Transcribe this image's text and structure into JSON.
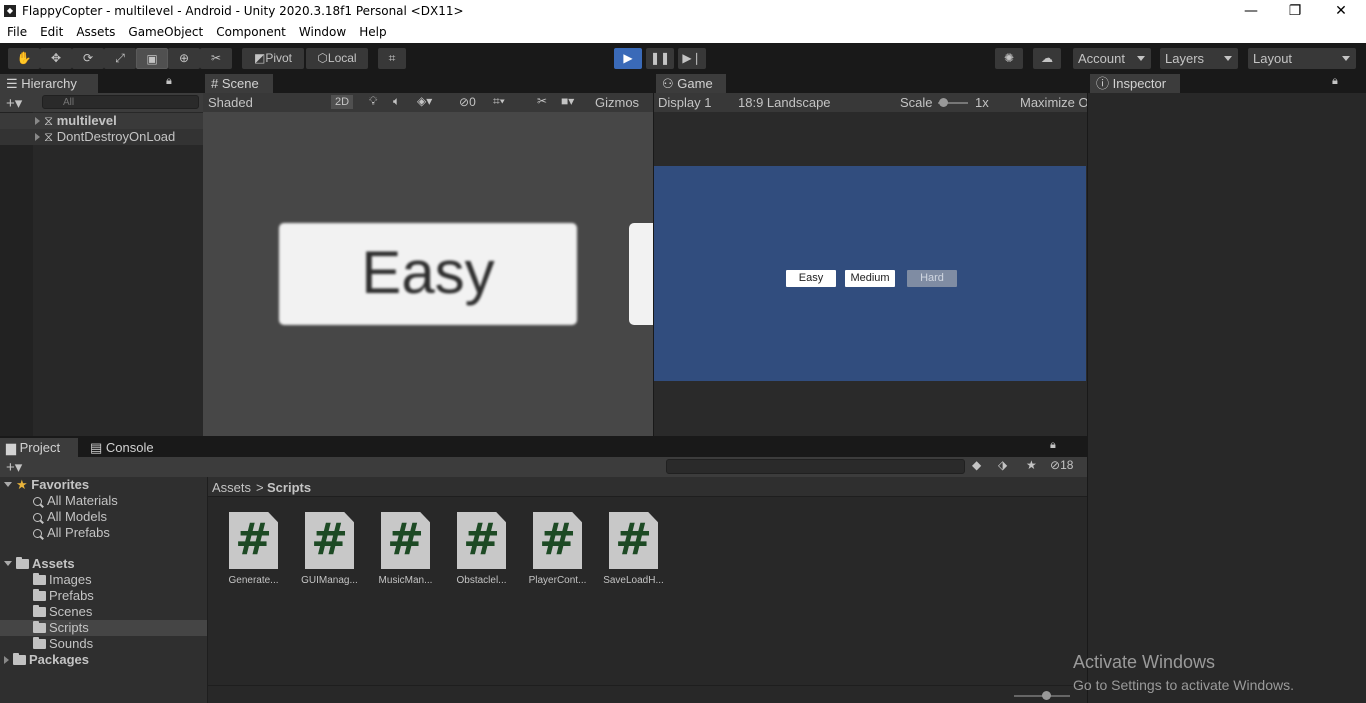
{
  "window": {
    "title": "FlappyCopter - multilevel - Android - Unity 2020.3.18f1 Personal <DX11>",
    "minimize": "—",
    "maximize": "❐",
    "close": "✕"
  },
  "menu": [
    "File",
    "Edit",
    "Assets",
    "GameObject",
    "Component",
    "Window",
    "Help"
  ],
  "toolbar": {
    "pivot": "Pivot",
    "local": "Local",
    "account": "Account",
    "layers": "Layers",
    "layout": "Layout"
  },
  "hierarchy": {
    "tab": "Hierarchy",
    "search_placeholder": "All",
    "items": [
      "multilevel",
      "DontDestroyOnLoad"
    ]
  },
  "scene": {
    "tab": "Scene",
    "shading": "Shaded",
    "mode2d": "2D",
    "hidden_count": "0",
    "gizmos": "Gizmos",
    "easy_label": "Easy"
  },
  "game": {
    "tab": "Game",
    "display": "Display 1",
    "aspect": "18:9 Landscape",
    "scale_label": "Scale",
    "scale_value": "1x",
    "maximize": "Maximize O",
    "buttons": [
      "Easy",
      "Medium",
      "Hard"
    ],
    "bg_color": "#314d7e"
  },
  "inspector": {
    "tab": "Inspector"
  },
  "project": {
    "tab": "Project",
    "console_tab": "Console",
    "hidden_count": "18",
    "favorites": {
      "label": "Favorites",
      "items": [
        "All Materials",
        "All Models",
        "All Prefabs"
      ]
    },
    "assets": {
      "label": "Assets",
      "folders": [
        "Images",
        "Prefabs",
        "Scenes",
        "Scripts",
        "Sounds"
      ]
    },
    "packages": "Packages",
    "breadcrumb": {
      "root": "Assets",
      "sep": ">",
      "current": "Scripts"
    },
    "scripts": [
      "Generate...",
      "GUIManag...",
      "MusicMan...",
      "Obstaclel...",
      "PlayerCont...",
      "SaveLoadH..."
    ]
  },
  "watermark": {
    "line1": "Activate Windows",
    "line2": "Go to Settings to activate Windows."
  }
}
